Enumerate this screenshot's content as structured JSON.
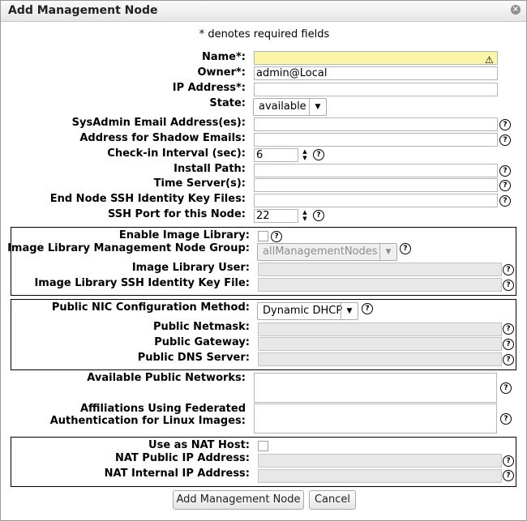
{
  "dialog": {
    "title": "Add Management Node",
    "required_note": "* denotes required fields"
  },
  "icons": {
    "help": "?",
    "close": "⊗",
    "warning": "⚠"
  },
  "fields": {
    "name": {
      "label": "Name*:",
      "value": ""
    },
    "owner": {
      "label": "Owner*:",
      "value": "admin@Local"
    },
    "ip_address": {
      "label": "IP Address*:",
      "value": ""
    },
    "state": {
      "label": "State:",
      "value": "available"
    },
    "sysadmin_email": {
      "label": "SysAdmin Email Address(es):",
      "value": ""
    },
    "shadow_email": {
      "label": "Address for Shadow Emails:",
      "value": ""
    },
    "checkin_interval": {
      "label": "Check-in Interval (sec):",
      "value": "6"
    },
    "install_path": {
      "label": "Install Path:",
      "value": ""
    },
    "time_servers": {
      "label": "Time Server(s):",
      "value": ""
    },
    "ssh_key_files": {
      "label": "End Node SSH Identity Key Files:",
      "value": ""
    },
    "ssh_port": {
      "label": "SSH Port for this Node:",
      "value": "22"
    }
  },
  "image_library": {
    "enable_label": "Enable Image Library:",
    "enabled": false,
    "group_label": "Image Library Management Node Group:",
    "group_value": "allManagementNodes",
    "user_label": "Image Library User:",
    "user_value": "",
    "key_label": "Image Library SSH Identity Key File:",
    "key_value": ""
  },
  "public_nic": {
    "method_label": "Public NIC Configuration Method:",
    "method_value": "Dynamic DHCP",
    "netmask_label": "Public Netmask:",
    "gateway_label": "Public Gateway:",
    "dns_label": "Public DNS Server:"
  },
  "networks": {
    "available_label": "Available Public Networks:",
    "affiliations_label_line1": "Affiliations Using Federated",
    "affiliations_label_line2": "Authentication for Linux Images:"
  },
  "nat": {
    "use_label": "Use as NAT Host:",
    "use_checked": false,
    "public_ip_label": "NAT Public IP Address:",
    "internal_ip_label": "NAT Internal IP Address:"
  },
  "buttons": {
    "add": "Add Management Node",
    "cancel": "Cancel"
  }
}
